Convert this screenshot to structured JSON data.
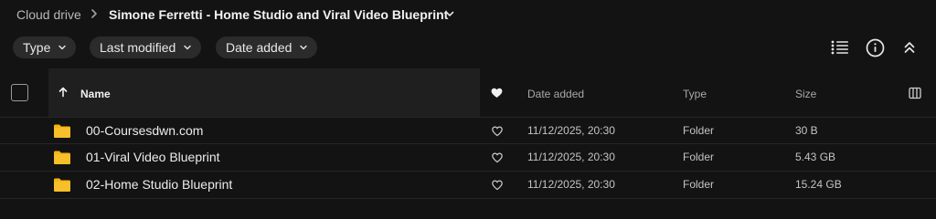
{
  "breadcrumb": {
    "root": "Cloud drive",
    "current": "Simone Ferretti - Home Studio and Viral Video Blueprint"
  },
  "filters": [
    {
      "label": "Type"
    },
    {
      "label": "Last modified"
    },
    {
      "label": "Date added"
    }
  ],
  "toolbar": {
    "icons": [
      "list-view-icon",
      "info-icon",
      "collapse-icon"
    ]
  },
  "table": {
    "columns": {
      "name": "Name",
      "date_added": "Date added",
      "type": "Type",
      "size": "Size"
    },
    "rows": [
      {
        "name": "00-Coursesdwn.com",
        "date_added": "11/12/2025, 20:30",
        "type": "Folder",
        "size": "30 B"
      },
      {
        "name": "01-Viral Video Blueprint",
        "date_added": "11/12/2025, 20:30",
        "type": "Folder",
        "size": "5.43 GB"
      },
      {
        "name": "02-Home Studio Blueprint",
        "date_added": "11/12/2025, 20:30",
        "type": "Folder",
        "size": "15.24 GB"
      }
    ]
  },
  "colors": {
    "background": "#131313",
    "pill": "#2b2b2b",
    "folder": "#f5b512",
    "name_header": "#1f1f1f"
  }
}
